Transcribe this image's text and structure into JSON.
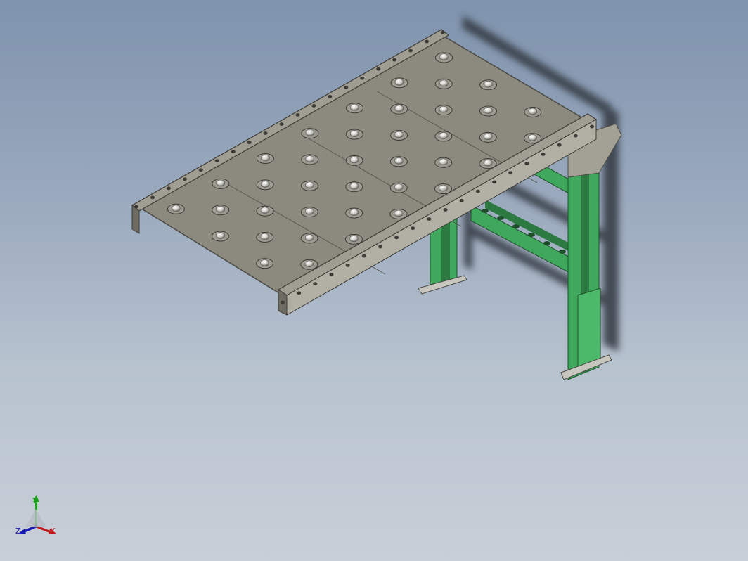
{
  "viewport": {
    "background_top": "#7f93ad",
    "background_bottom": "#c8cfd8"
  },
  "model": {
    "parts": [
      "ball-transfer-table",
      "ball-transfer-unit",
      "side-rail",
      "support-stand",
      "foot-plate",
      "mounting-bolt",
      "shadow"
    ],
    "colors": {
      "table": "#8c8a7e",
      "table_edge": "#5a5850",
      "stand": "#3fa85c",
      "stand_dark": "#2c7a42",
      "ball_cup": "#9c9a90",
      "ball": "#e0e0dc",
      "shadow": "#333841"
    }
  },
  "triad": {
    "x_label": "X",
    "y_label": "Y",
    "z_label": "Z",
    "x_color": "#c21a1a",
    "y_color": "#1aa31a",
    "z_color": "#1a1ab5"
  }
}
